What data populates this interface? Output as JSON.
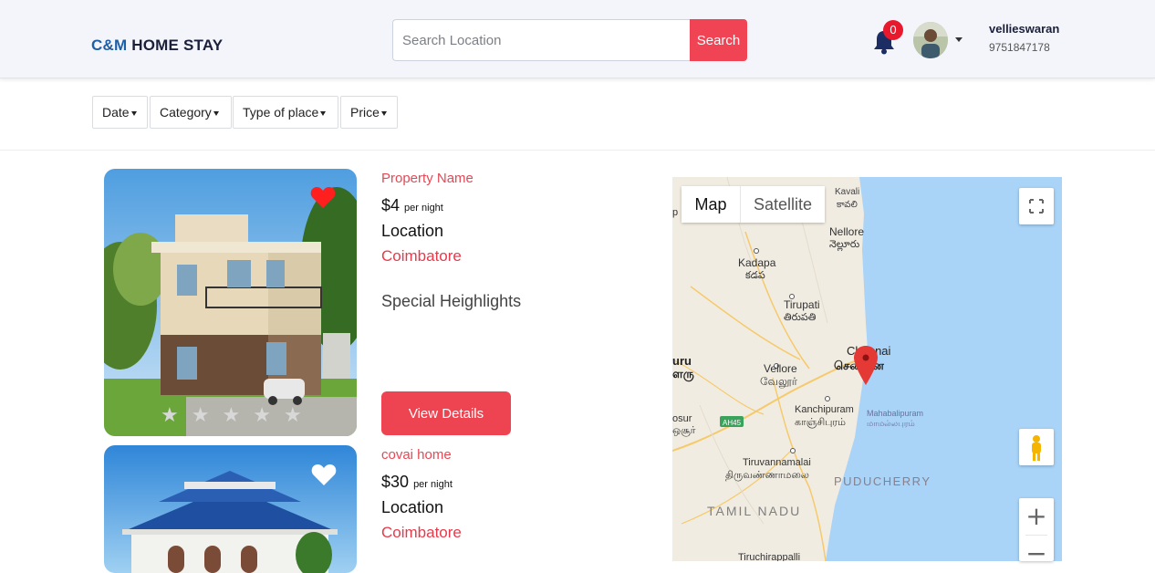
{
  "header": {
    "brand_part1": "C&M",
    "brand_part2": "HOME STAY",
    "search_placeholder": "Search Location",
    "search_button": "Search",
    "notification_count": "0",
    "user_name": "vellieswaran",
    "user_phone": "9751847178"
  },
  "filters": [
    {
      "label": "Date"
    },
    {
      "label": "Category"
    },
    {
      "label": "Type of place"
    },
    {
      "label": "Price"
    }
  ],
  "listings": [
    {
      "name": "Property Name",
      "price": "$4",
      "price_unit": "per night",
      "location_label": "Location",
      "location": "Coimbatore",
      "highlights": "Special Heighlights",
      "button": "View Details",
      "favorite": true,
      "rating": 0,
      "rating_max": 5
    },
    {
      "name": "covai home",
      "price": "$30",
      "price_unit": "per night",
      "location_label": "Location",
      "location": "Coimbatore",
      "favorite": false
    }
  ],
  "map": {
    "tab_map": "Map",
    "tab_satellite": "Satellite",
    "active_tab": "Map",
    "zoom_in": "+",
    "zoom_out": "−",
    "labels": [
      {
        "text": "Kavali"
      },
      {
        "text": "కావలి"
      },
      {
        "text": "Nellore"
      },
      {
        "text": "నెల్లూరు"
      },
      {
        "text": "Kadapa"
      },
      {
        "text": "కడప"
      },
      {
        "text": "Tirupati"
      },
      {
        "text": "తిరుపతి"
      },
      {
        "text": "Chennai"
      },
      {
        "text": "சென்னை"
      },
      {
        "text": "Vellore"
      },
      {
        "text": "வேலூர்"
      },
      {
        "text": "Kanchipuram"
      },
      {
        "text": "காஞ்சிபுரம்"
      },
      {
        "text": "Mahabalipuram"
      },
      {
        "text": "மாமல்லபுரம்"
      },
      {
        "text": "Tiruvannamalai"
      },
      {
        "text": "திருவண்ணாமலை"
      },
      {
        "text": "PUDUCHERRY"
      },
      {
        "text": "TAMIL NADU"
      },
      {
        "text": "Tiruchirappalli"
      },
      {
        "text": "AH45"
      },
      {
        "text": "uru"
      },
      {
        "text": "ளரு"
      },
      {
        "text": "osur"
      },
      {
        "text": "ஒசூர்"
      },
      {
        "text": "p"
      }
    ]
  },
  "colors": {
    "accent": "#ee4350",
    "brand_blue": "#1d5fa8",
    "header_bg": "#f3f5fb",
    "water": "#a9d3f7"
  }
}
